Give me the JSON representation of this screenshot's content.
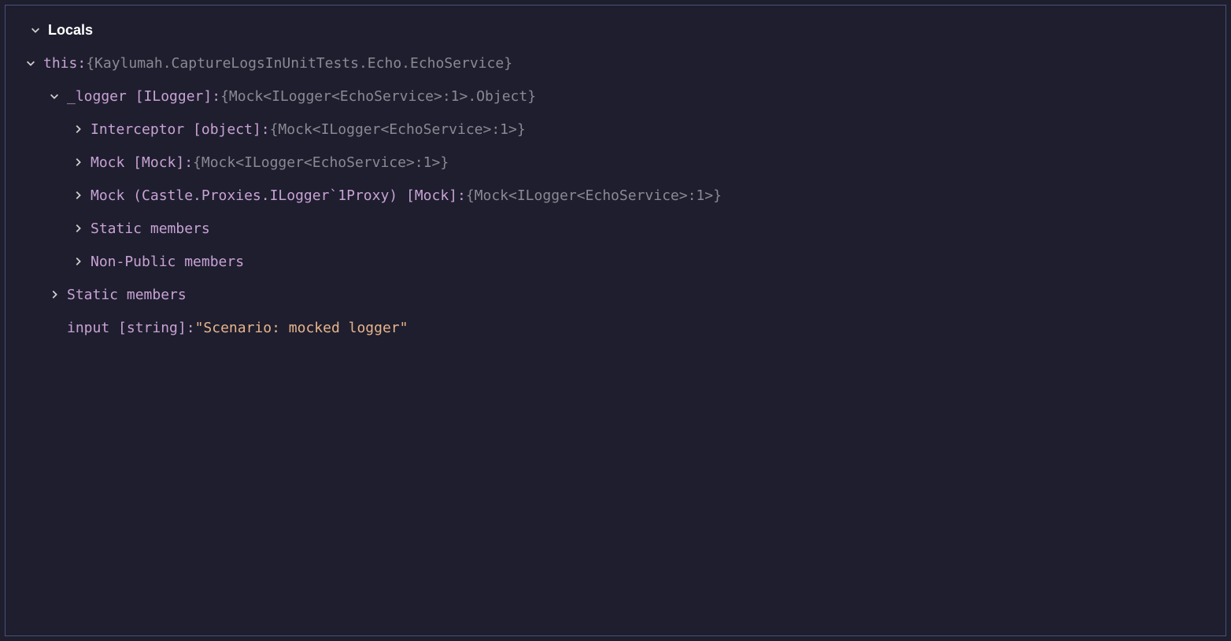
{
  "header": {
    "title": "Locals"
  },
  "rows": [
    {
      "indent": 22,
      "chevron": "down",
      "key": "this:",
      "value": "{Kaylumah.CaptureLogsInUnitTests.Echo.EchoService}",
      "valueClass": "val-gray"
    },
    {
      "indent": 52,
      "chevron": "down",
      "key": "_logger [ILogger]:",
      "value": "{Mock<ILogger<EchoService>:1>.Object}",
      "valueClass": "val-gray"
    },
    {
      "indent": 82,
      "chevron": "right",
      "key": "Interceptor [object]:",
      "value": "{Mock<ILogger<EchoService>:1>}",
      "valueClass": "val-gray"
    },
    {
      "indent": 82,
      "chevron": "right",
      "key": "Mock [Mock]:",
      "value": "{Mock<ILogger<EchoService>:1>}",
      "valueClass": "val-gray"
    },
    {
      "indent": 82,
      "chevron": "right",
      "key": "Mock (Castle.Proxies.ILogger`1Proxy) [Mock]:",
      "value": "{Mock<ILogger<EchoService>:1>}",
      "valueClass": "val-gray"
    },
    {
      "indent": 82,
      "chevron": "right",
      "key": "Static members",
      "value": "",
      "valueClass": "val-gray"
    },
    {
      "indent": 82,
      "chevron": "right",
      "key": "Non-Public members",
      "value": "",
      "valueClass": "val-gray"
    },
    {
      "indent": 52,
      "chevron": "right",
      "key": "Static members",
      "value": "",
      "valueClass": "val-gray"
    },
    {
      "indent": 52,
      "chevron": "none",
      "key": "input [string]:",
      "value": "\"Scenario: mocked logger\"",
      "valueClass": "val-orange"
    }
  ]
}
